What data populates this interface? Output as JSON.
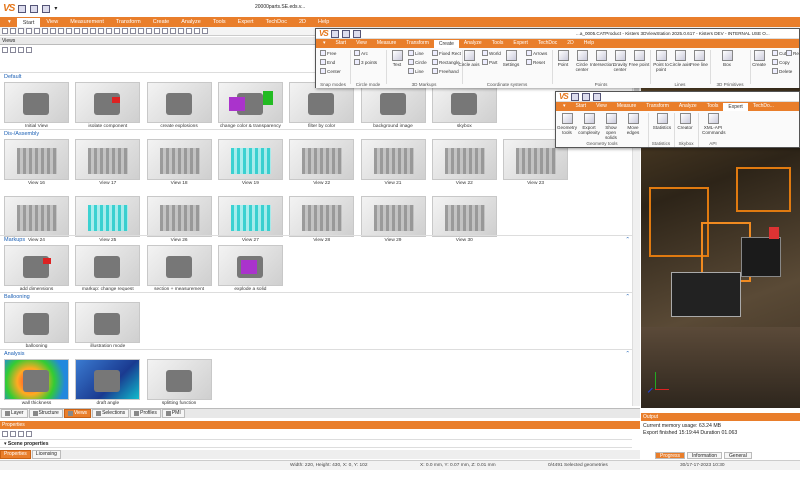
{
  "app": {
    "logo": "VS",
    "main_title_partial": "20000parts.SE.eds.v...",
    "menu": [
      "▾",
      "Start",
      "View",
      "Measurement",
      "Transform",
      "Create",
      "Analyze",
      "Tools",
      "Expert",
      "TechDoc",
      "2D",
      "Help"
    ],
    "active_menu": "Start"
  },
  "views_panel": {
    "header": "Views",
    "sections": [
      {
        "title": "Default",
        "items": [
          "Initial View",
          "isolate component",
          "create explosions",
          "change color & transparency",
          "filter by color",
          "background image",
          "skybox"
        ]
      },
      {
        "title": "Dis-/Assembly",
        "items": [
          "View 16",
          "View 17",
          "View 18",
          "View 19",
          "View 22",
          "View 21",
          "View 22",
          "View 23",
          "View 24",
          "View 25",
          "View 26",
          "View 27",
          "View 28",
          "View 29",
          "View 30"
        ]
      },
      {
        "title": "Markups",
        "items": [
          "add dimensions",
          "markup: change request",
          "section + measurement",
          "explode a solid"
        ]
      },
      {
        "title": "Ballooning",
        "items": [
          "ballooning",
          "illustration mode"
        ]
      },
      {
        "title": "Analysis",
        "items": [
          "wall thickness",
          "draft angle",
          "splitting function"
        ]
      }
    ]
  },
  "panel_tabs": [
    "Layer",
    "Structure",
    "Views",
    "Selections",
    "Profiles",
    "PMI"
  ],
  "active_panel_tab": "Views",
  "properties": {
    "header": "Properties",
    "row": "Scene properties",
    "tabs": [
      "Properties",
      "Licensing"
    ],
    "active_tab": "Properties"
  },
  "output": {
    "header": "Output",
    "lines": [
      "Current memory usage: 63.24 MB",
      "Export finished 15:19:44 Duration 01.063"
    ],
    "tabs": [
      "Progress",
      "Information",
      "General"
    ],
    "active_tab": "Progress"
  },
  "status": {
    "dims": "Width: 220, Height: 430, X: 0, Y: 102",
    "coords": "X: 0.0 mm, Y: 0.07 mm, Z: 0.01 mm",
    "selected": "0/4491 Selected geometries",
    "date": "30/17-17-2023 10:30"
  },
  "create_window": {
    "title": "...a_0005.CATProduct - Kisters 3DViewStation 2025.0.617 - Kisters DEV - INTERNAL USE O...",
    "menu": [
      "▾",
      "Start",
      "View",
      "Measure",
      "Transform",
      "Create",
      "Analyze",
      "Tools",
      "Expert",
      "TechDoc",
      "2D",
      "Help"
    ],
    "active_menu": "Create",
    "snap_modes": {
      "label": "Snap modes",
      "items": [
        "Free",
        "End",
        "Center"
      ]
    },
    "circle_mode": {
      "label": "Circle mode",
      "items": [
        "Arc",
        "3 points"
      ]
    },
    "markups": {
      "label": "3D Markups",
      "text": "Text",
      "items": [
        "Line",
        "Circle",
        "Line",
        "Fixed Rect",
        "Rectangle",
        "Freehand"
      ]
    },
    "coordinate_systems": {
      "label": "Coordinate systems",
      "items": [
        "Circle axis",
        "World",
        "Part",
        "Settings",
        "Arrows",
        "Reset"
      ]
    },
    "points": {
      "label": "Points",
      "items": [
        "Point",
        "Circle center",
        "Intersection",
        "Gravity center",
        "Free point"
      ]
    },
    "lines": {
      "label": "Lines",
      "items": [
        "Point to point",
        "Circle axis",
        "Free line"
      ]
    },
    "primitives": {
      "label": "3D Primitives",
      "items": [
        "Box"
      ]
    },
    "edit": {
      "items": [
        "Create",
        "Cut",
        "Copy",
        "Delete",
        "Re..."
      ]
    }
  },
  "expert_window": {
    "menu": [
      "▾",
      "Start",
      "View",
      "Measure",
      "Transform",
      "Analyze",
      "Tools",
      "Expert",
      "TechDo..."
    ],
    "active_menu": "Expert",
    "geometry_tools": {
      "label": "Geometry tools",
      "items": [
        "Geometry tools",
        "Export complexity",
        "Show open solids",
        "Move edges"
      ]
    },
    "statistics": {
      "label": "Statistics",
      "items": [
        "Statistics"
      ]
    },
    "skybox": {
      "label": "Skybox",
      "items": [
        "Creator"
      ]
    },
    "api": {
      "label": "API",
      "items": [
        "XML-API Commands"
      ]
    }
  },
  "colors": {
    "accent": "#e97e2b",
    "section": "#1a5fb4"
  }
}
